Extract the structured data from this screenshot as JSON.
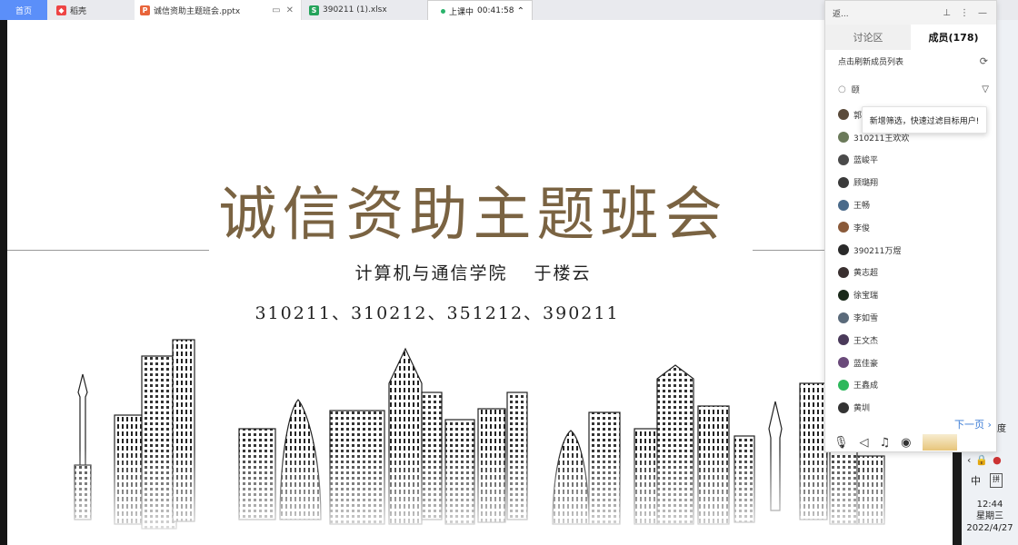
{
  "tabs": {
    "home": "首页",
    "daoke": "稻壳",
    "pptx": "诚信资助主题班会.pptx",
    "xlsx": "390211 (1).xlsx"
  },
  "class_status": {
    "label": "上课中",
    "timer": "00:41:58"
  },
  "slide": {
    "title": "诚信资助主题班会",
    "subtitle": "计算机与通信学院　 于楼云",
    "classes": "310211、310212、351212、390211"
  },
  "panel": {
    "back_label": "返...",
    "tab_discussion": "讨论区",
    "tab_members": "成员(178)",
    "refresh_label": "点击刷新成员列表",
    "search_value": "颐",
    "tooltip": "新增筛选，快速过滤目标用户!",
    "next_page": "下一页",
    "members": [
      {
        "name": "郭",
        "color": "#5a4a3a"
      },
      {
        "name": "310211王欢欢",
        "color": "#6b7a5a"
      },
      {
        "name": "蓝峻平",
        "color": "#4a4a4a"
      },
      {
        "name": "顾璐翔",
        "color": "#3a3a3a"
      },
      {
        "name": "王畅",
        "color": "#4a6a8a"
      },
      {
        "name": "李俊",
        "color": "#8a5a3a"
      },
      {
        "name": "390211万煜",
        "color": "#2a2a2a"
      },
      {
        "name": "黄志超",
        "color": "#3a3030"
      },
      {
        "name": "徐宝瑞",
        "color": "#1a2a1a"
      },
      {
        "name": "李如雪",
        "color": "#5a6a7a"
      },
      {
        "name": "王文杰",
        "color": "#4a3a5a"
      },
      {
        "name": "蓝佳豪",
        "color": "#6a4a7a"
      },
      {
        "name": "王鑫成",
        "color": "#2eb85c"
      },
      {
        "name": "黄圳",
        "color": "#333333"
      }
    ]
  },
  "taskbar": {
    "cut_text": "度",
    "ime_lang": "中",
    "ime_kb": "拼",
    "time": "12:44",
    "weekday": "星期三",
    "date": "2022/4/27"
  }
}
